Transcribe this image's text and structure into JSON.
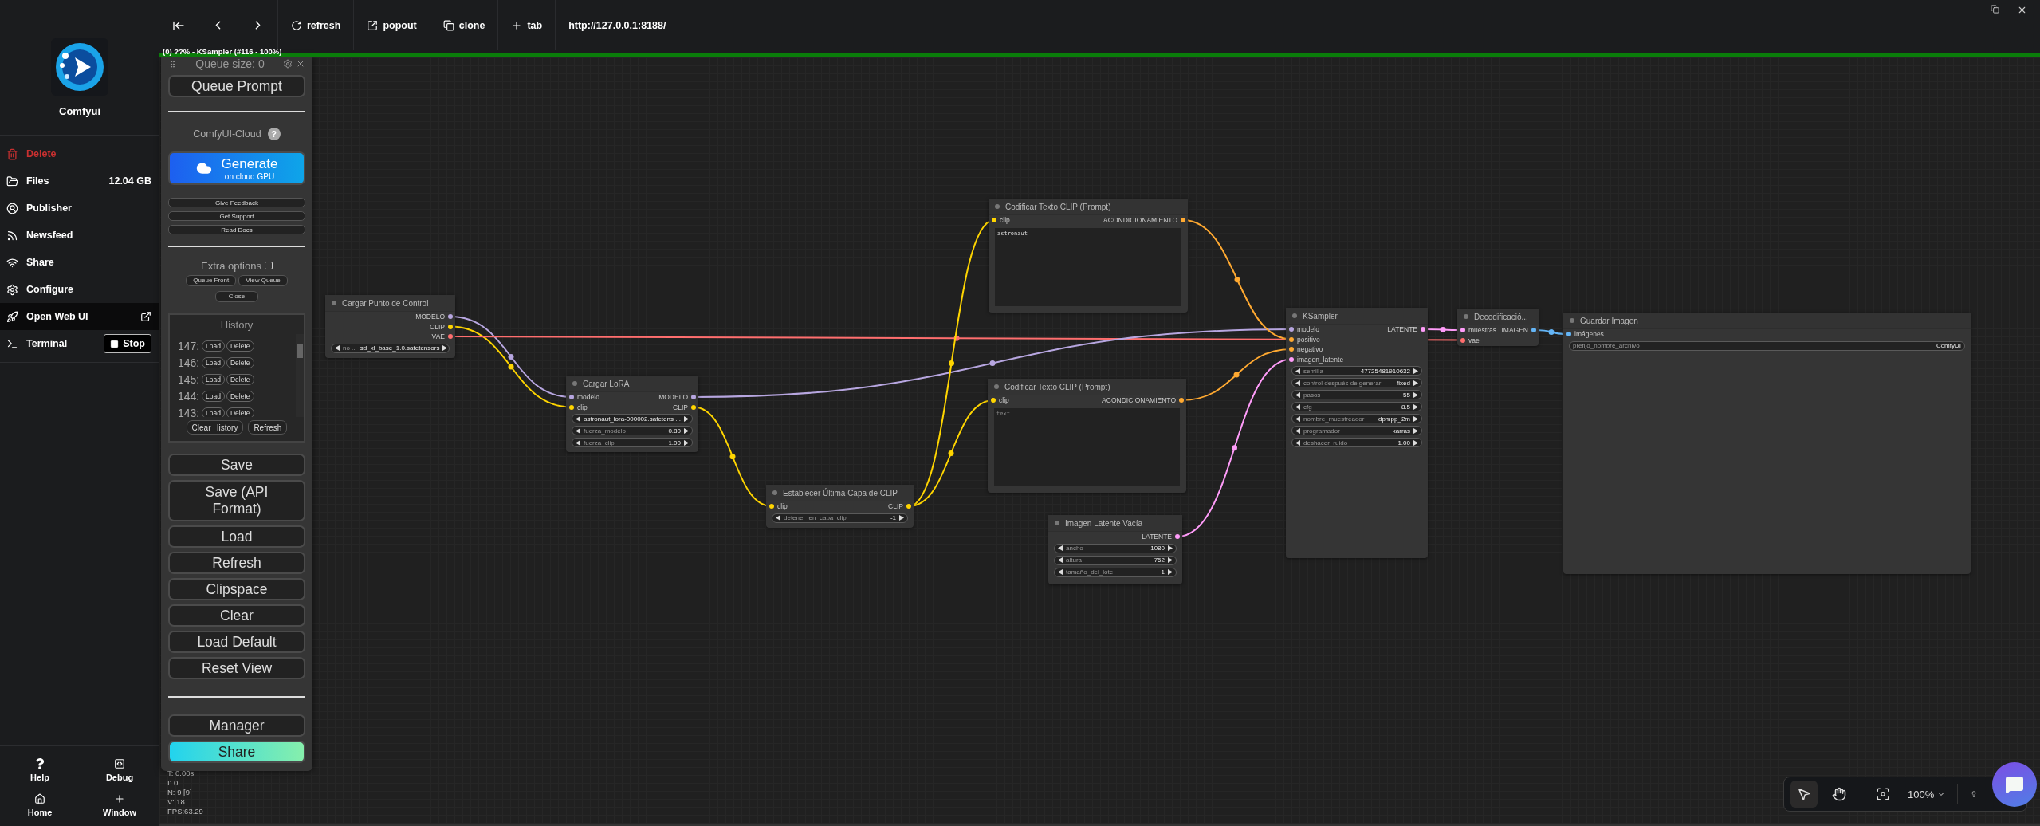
{
  "sidebar": {
    "app_name": "Comfyui",
    "items": [
      {
        "label": "Delete",
        "kind": "danger",
        "selected": false
      },
      {
        "label": "Files",
        "kind": "stat",
        "value": "12.04 GB",
        "selected": false
      },
      {
        "label": "Publisher",
        "kind": "plain",
        "selected": false
      },
      {
        "label": "Newsfeed",
        "kind": "plain",
        "selected": false
      },
      {
        "label": "Share",
        "kind": "plain",
        "selected": false
      },
      {
        "label": "Configure",
        "kind": "plain",
        "selected": false
      },
      {
        "label": "Open Web UI",
        "kind": "external",
        "selected": true
      },
      {
        "label": "Terminal",
        "kind": "process",
        "button": "Stop",
        "selected": false
      }
    ],
    "footer": [
      {
        "label": "Help"
      },
      {
        "label": "Debug"
      },
      {
        "label": "Home"
      },
      {
        "label": "Window"
      }
    ]
  },
  "browser_bar": {
    "buttons": [
      {
        "label": "refresh"
      },
      {
        "label": "popout"
      },
      {
        "label": "clone"
      },
      {
        "label": "tab"
      }
    ],
    "url": "http://127.0.0.1:8188/"
  },
  "progress": {
    "text": "(0) ??% - KSampler (#116 - 100%)",
    "level": 1
  },
  "menu": {
    "queue_size": "Queue size: 0",
    "queue_button": "Queue Prompt",
    "cloud_title": "ComfyUI-Cloud",
    "help_mark": "?",
    "generate": {
      "title": "Generate",
      "subtitle": "on cloud GPU"
    },
    "links": [
      "Give Feedback",
      "Get Support",
      "Read Docs"
    ],
    "extra_options": {
      "label": "Extra options",
      "checked": false
    },
    "queue_buttons": [
      "Queue Front",
      "View Queue",
      "Close"
    ],
    "history": {
      "title": "History",
      "items": [
        {
          "number": "147:",
          "load": "Load",
          "delete": "Delete"
        },
        {
          "number": "146:",
          "load": "Load",
          "delete": "Delete"
        },
        {
          "number": "145:",
          "load": "Load",
          "delete": "Delete"
        },
        {
          "number": "144:",
          "load": "Load",
          "delete": "Delete"
        },
        {
          "number": "143:",
          "load": "Load",
          "delete": "Delete"
        }
      ],
      "buttons": [
        "Clear History",
        "Refresh"
      ]
    },
    "actions": [
      "Save",
      "Save (API Format)",
      "Load",
      "Refresh",
      "Clipspace",
      "Clear",
      "Load Default",
      "Reset View"
    ],
    "extra_actions": [
      {
        "label": "Manager",
        "kind": "plain"
      },
      {
        "label": "Share",
        "kind": "gradient"
      }
    ]
  },
  "stats": [
    "T: 0.00s",
    "I: 0",
    "N: 9 [9]",
    "V: 18",
    "FPS:63.29"
  ],
  "nodes": [
    {
      "title": "Cargar Punto de Control",
      "outputs": [
        {
          "label": "MODELO",
          "color": "#b7a6e0"
        },
        {
          "label": "CLIP",
          "color": "#ffd500"
        },
        {
          "label": "VAE",
          "color": "#ff6e6e"
        }
      ],
      "widgets": [
        {
          "kind": "combo",
          "label": "no ...",
          "value": "sd_xl_base_1.0.safetensors"
        }
      ]
    },
    {
      "title": "Cargar LoRA",
      "inputs": [
        {
          "label": "modelo",
          "color": "#b7a6e0"
        },
        {
          "label": "clip",
          "color": "#ffd500"
        }
      ],
      "outputs": [
        {
          "label": "MODELO",
          "color": "#b7a6e0"
        },
        {
          "label": "CLIP",
          "color": "#ffd500"
        }
      ],
      "widgets": [
        {
          "kind": "combo",
          "value": "astronaut_lora-000002.safetens ..."
        },
        {
          "kind": "number",
          "label": "fuerza_modelo",
          "value": "0.80"
        },
        {
          "kind": "number",
          "label": "fuerza_clip",
          "value": "1.00"
        }
      ]
    },
    {
      "title": "Establecer Última Capa de CLIP",
      "inputs": [
        {
          "label": "clip",
          "color": "#ffd500"
        }
      ],
      "outputs": [
        {
          "label": "CLIP",
          "color": "#ffd500"
        }
      ],
      "widgets": [
        {
          "kind": "number",
          "label": "detener_en_capa_clip",
          "value": "-1"
        }
      ]
    },
    {
      "title": "Codificar Texto CLIP (Prompt)",
      "inputs": [
        {
          "label": "clip",
          "color": "#ffd500"
        }
      ],
      "outputs": [
        {
          "label": "ACONDICIONAMIENTO",
          "color": "#ffa931"
        }
      ],
      "widgets": [
        {
          "kind": "prompt",
          "value": "astronaut"
        }
      ]
    },
    {
      "title": "Codificar Texto CLIP (Prompt)",
      "inputs": [
        {
          "label": "clip",
          "color": "#ffd500"
        }
      ],
      "outputs": [
        {
          "label": "ACONDICIONAMIENTO",
          "color": "#ffa931"
        }
      ],
      "widgets": [
        {
          "kind": "prompt",
          "placeholder": "text"
        }
      ]
    },
    {
      "title": "Imagen Latente Vacía",
      "outputs": [
        {
          "label": "LATENTE",
          "color": "#ff9cf9"
        }
      ],
      "widgets": [
        {
          "kind": "number",
          "label": "ancho",
          "value": "1080"
        },
        {
          "kind": "number",
          "label": "altura",
          "value": "752"
        },
        {
          "kind": "number",
          "label": "tamaño_del_lote",
          "value": "1"
        }
      ]
    },
    {
      "title": "KSampler",
      "inputs": [
        {
          "label": "modelo",
          "color": "#b7a6e0"
        },
        {
          "label": "positivo",
          "color": "#ffa931"
        },
        {
          "label": "negativo",
          "color": "#ffa931"
        },
        {
          "label": "imagen_latente",
          "color": "#ff9cf9"
        }
      ],
      "outputs": [
        {
          "label": "LATENTE",
          "color": "#ff9cf9"
        }
      ],
      "widgets": [
        {
          "kind": "number",
          "label": "semilla",
          "value": "47725481910632"
        },
        {
          "kind": "combo",
          "label": "control después de generar",
          "value": "fixed"
        },
        {
          "kind": "number",
          "label": "pasos",
          "value": "55"
        },
        {
          "kind": "number",
          "label": "cfg",
          "value": "8.5"
        },
        {
          "kind": "combo",
          "label": "nombre_muestreador",
          "value": "dpmpp_2m"
        },
        {
          "kind": "combo",
          "label": "programador",
          "value": "karras"
        },
        {
          "kind": "number",
          "label": "deshacer_ruido",
          "value": "1.00"
        }
      ]
    },
    {
      "title": "Decodificació...",
      "inputs": [
        {
          "label": "muestras",
          "color": "#ff9cf9"
        },
        {
          "label": "vae",
          "color": "#ff6e6e"
        }
      ],
      "outputs": [
        {
          "label": "IMAGEN",
          "color": "#64b5f6"
        }
      ]
    },
    {
      "title": "Guardar Imagen",
      "inputs": [
        {
          "label": "imágenes",
          "color": "#64b5f6"
        }
      ],
      "widgets": [
        {
          "kind": "text",
          "label": "prefijo_nombre_archivo",
          "value": "ComfyUI"
        }
      ]
    }
  ],
  "canvas_toolbar": {
    "zoom": "100%"
  }
}
